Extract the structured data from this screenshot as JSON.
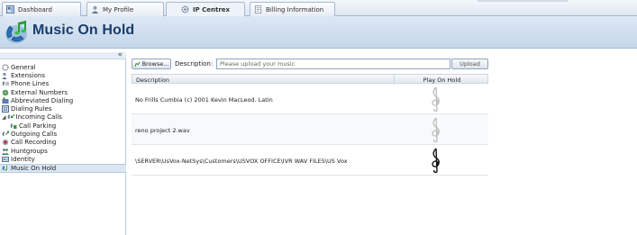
{
  "tabs": [
    {
      "label": "Dashboard",
      "icon": "dashboard-icon"
    },
    {
      "label": "My Profile",
      "icon": "user-icon"
    },
    {
      "label": "IP Centrex",
      "icon": "gear-icon"
    },
    {
      "label": "Billing Information",
      "icon": "billing-icon"
    }
  ],
  "header": {
    "title": "Music On Hold",
    "icon": "phone-music-icon"
  },
  "sidebar": {
    "collapse_label": "«",
    "items": [
      {
        "label": "General",
        "icon": "general-icon"
      },
      {
        "label": "Extensions",
        "icon": "extensions-icon"
      },
      {
        "label": "Phone Lines",
        "icon": "phone-lines-icon"
      },
      {
        "label": "External Numbers",
        "icon": "external-numbers-icon"
      },
      {
        "label": "Abbreviated Dialing",
        "icon": "abbreviated-dialing-icon"
      },
      {
        "label": "Dialing Rules",
        "icon": "dialing-rules-icon"
      },
      {
        "label": "Incoming Calls",
        "icon": "incoming-calls-icon"
      },
      {
        "label": "Call Parking",
        "icon": "call-parking-icon"
      },
      {
        "label": "Outgoing Calls",
        "icon": "outgoing-calls-icon"
      },
      {
        "label": "Call Recording",
        "icon": "call-recording-icon"
      },
      {
        "label": "Huntgroups",
        "icon": "huntgroups-icon"
      },
      {
        "label": "Identity",
        "icon": "identity-icon"
      },
      {
        "label": "Music On Hold",
        "icon": "music-on-hold-icon"
      }
    ]
  },
  "toolbar": {
    "browse_label": "Browse...",
    "description_label": "Description:",
    "description_placeholder": "Please upload your music",
    "upload_label": "Upload"
  },
  "grid": {
    "columns": [
      "Description",
      "Play On Hold"
    ],
    "rows": [
      {
        "description": "No Frills Cumbia (c) 2001 Kevin MacLeod. Latin",
        "active": false
      },
      {
        "description": "reno project 2.wav",
        "active": false
      },
      {
        "description": "\\SERVER\\UsVox-NetSys\\Customers\\USVOX OFFICE\\IVR WAV FILES\\US Vox",
        "active": true
      }
    ]
  },
  "colors": {
    "accent": "#1a3d6d",
    "header_bg": "#c5d6ea",
    "selected": "#dbe6f3"
  }
}
